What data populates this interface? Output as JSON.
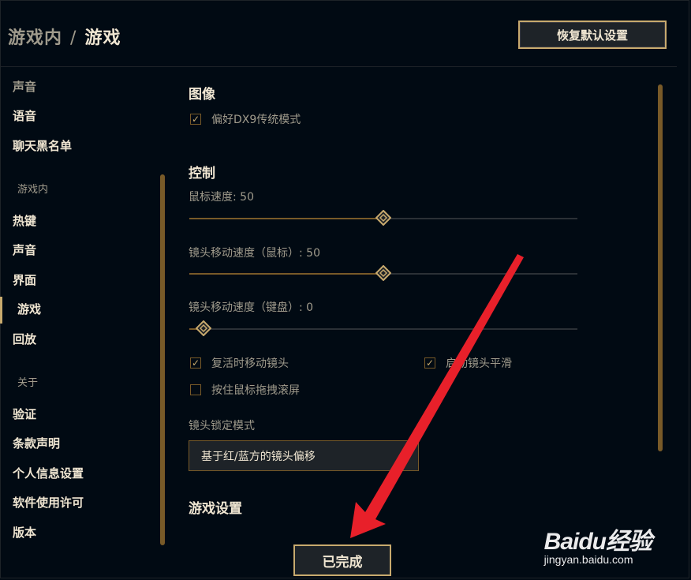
{
  "header": {
    "crumb": "游戏内",
    "separator": "/",
    "current": "游戏",
    "restore_label": "恢复默认设置"
  },
  "sidebar": {
    "items_top": [
      {
        "label": "声音"
      },
      {
        "label": "语音"
      },
      {
        "label": "聊天黑名单"
      }
    ],
    "section_ingame": "游戏内",
    "items_ingame": [
      {
        "label": "热键"
      },
      {
        "label": "声音"
      },
      {
        "label": "界面"
      },
      {
        "label": "游戏"
      },
      {
        "label": "回放"
      }
    ],
    "active": "游戏",
    "section_about": "关于",
    "items_about": [
      {
        "label": "验证"
      },
      {
        "label": "条款声明"
      },
      {
        "label": "个人信息设置"
      },
      {
        "label": "软件使用许可"
      },
      {
        "label": "版本"
      }
    ]
  },
  "main": {
    "graphics": {
      "title": "图像",
      "dx9_label": "偏好DX9传统模式",
      "dx9_checked": true
    },
    "controls": {
      "title": "控制",
      "mouse_speed_label": "鼠标速度: 50",
      "mouse_speed_value": 50,
      "cam_mouse_label": "镜头移动速度（鼠标）: 50",
      "cam_mouse_value": 50,
      "cam_keyboard_label": "镜头移动速度（键盘）: 0",
      "cam_keyboard_value": 0,
      "respawn_cam_label": "复活时移动镜头",
      "respawn_cam_checked": true,
      "smooth_cam_label": "启动镜头平滑",
      "smooth_cam_checked": true,
      "drag_scroll_label": "按住鼠标拖拽滚屏",
      "drag_scroll_checked": false,
      "lock_mode_label": "镜头锁定模式",
      "lock_mode_value": "基于红/蓝方的镜头偏移"
    },
    "game_settings_title": "游戏设置"
  },
  "footer": {
    "done_label": "已完成"
  },
  "watermark": {
    "logo_text": "Baidu经验",
    "url_text": "jingyan.baidu.com"
  },
  "colors": {
    "gold": "#c8aa6e",
    "gold_dark": "#785a28",
    "text_light": "#f0e6d2",
    "text_dim": "#a09b8c",
    "background": "#010a13",
    "arrow_red": "#e8202a"
  }
}
